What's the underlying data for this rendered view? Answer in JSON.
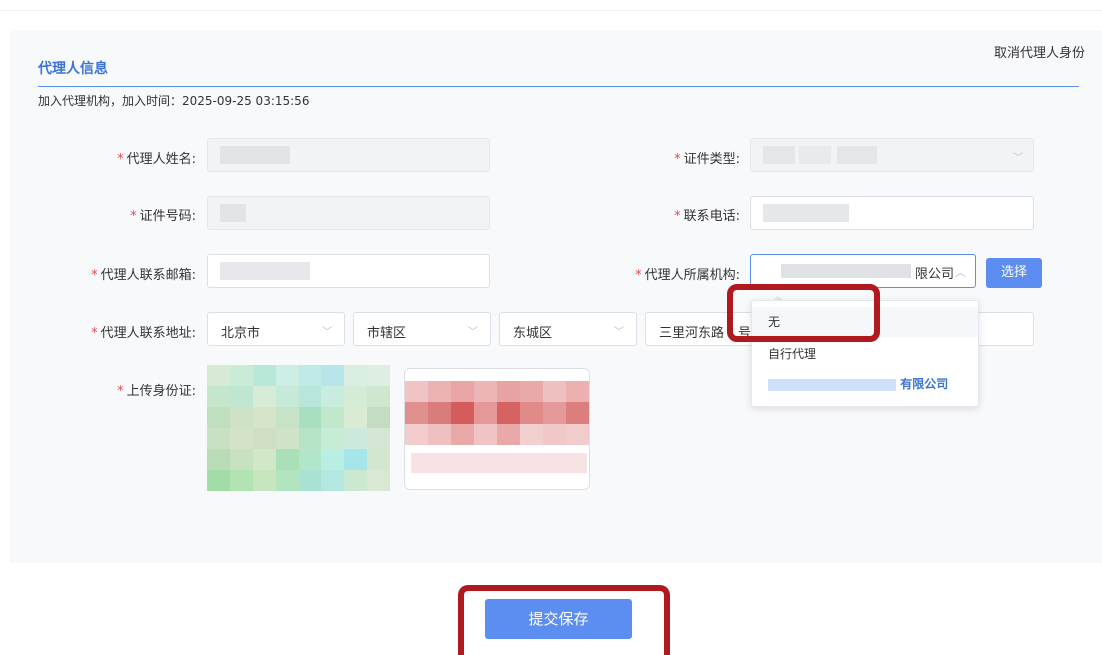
{
  "section": {
    "title": "代理人信息",
    "cancel_link": "取消代理人身份",
    "join_info": "加入代理机构，加入时间：2025-09-25 03:15:56"
  },
  "form": {
    "agent_name_label": "代理人姓名:",
    "id_type_label": "证件类型:",
    "id_number_label": "证件号码:",
    "phone_label": "联系电话:",
    "email_label": "代理人联系邮箱:",
    "org_label": "代理人所属机构:",
    "org_value_suffix": "限公司",
    "select_button": "选择",
    "address_label": "代理人联系地址:",
    "province": "北京市",
    "city": "市辖区",
    "district": "东城区",
    "street": "三里河东路",
    "street_suffix": "号",
    "upload_label": "上传身份证:"
  },
  "dropdown": {
    "options": [
      "无",
      "自行代理",
      "有限公司"
    ]
  },
  "actions": {
    "submit": "提交保存"
  },
  "colors": {
    "accent": "#5b8ef0",
    "title_blue": "#3b74d6",
    "required": "#e5484d",
    "highlight": "#b0191e"
  }
}
